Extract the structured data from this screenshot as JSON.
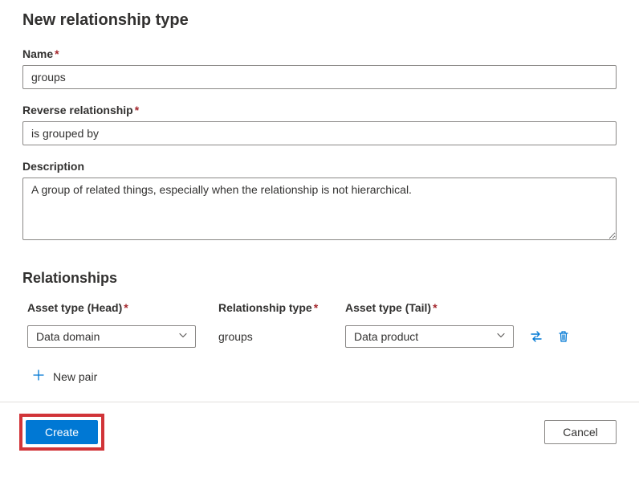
{
  "page_title": "New relationship type",
  "fields": {
    "name": {
      "label": "Name",
      "value": "groups",
      "required": true
    },
    "reverse": {
      "label": "Reverse relationship",
      "value": "is grouped by",
      "required": true
    },
    "description": {
      "label": "Description",
      "value": "A group of related things, especially when the relationship is not hierarchical.",
      "required": false
    }
  },
  "relationships": {
    "section_title": "Relationships",
    "columns": {
      "head": "Asset type (Head)",
      "reltype": "Relationship type",
      "tail": "Asset type (Tail)"
    },
    "rows": [
      {
        "head": "Data domain",
        "reltype": "groups",
        "tail": "Data product"
      }
    ],
    "new_pair_label": "New pair"
  },
  "footer": {
    "create": "Create",
    "cancel": "Cancel"
  },
  "required_marker": "*"
}
